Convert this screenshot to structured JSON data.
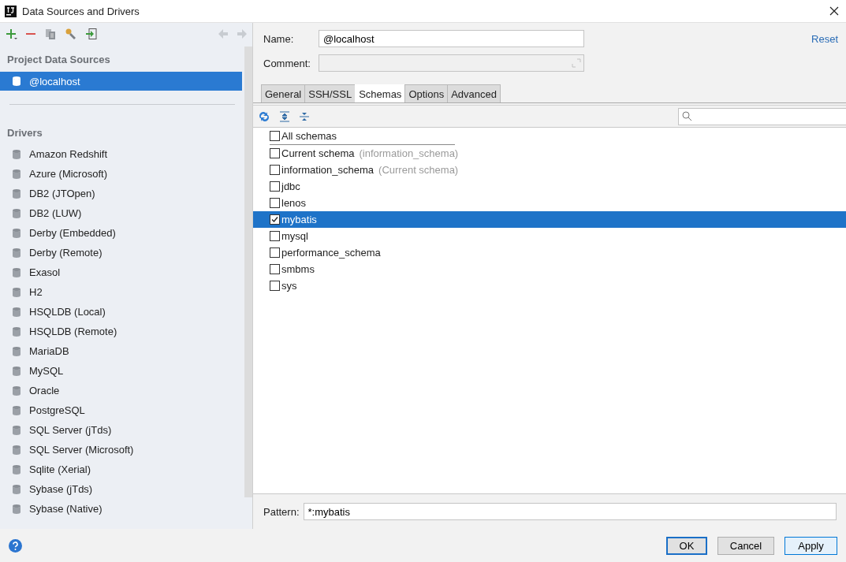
{
  "window": {
    "title": "Data Sources and Drivers"
  },
  "sidebar": {
    "sections": [
      {
        "title": "Project Data Sources",
        "items": [
          {
            "label": "@localhost",
            "selected": true
          }
        ]
      },
      {
        "title": "Drivers",
        "items": [
          {
            "label": "Amazon Redshift",
            "selected": false
          },
          {
            "label": "Azure (Microsoft)",
            "selected": false
          },
          {
            "label": "DB2 (JTOpen)",
            "selected": false
          },
          {
            "label": "DB2 (LUW)",
            "selected": false
          },
          {
            "label": "Derby (Embedded)",
            "selected": false
          },
          {
            "label": "Derby (Remote)",
            "selected": false
          },
          {
            "label": "Exasol",
            "selected": false
          },
          {
            "label": "H2",
            "selected": false
          },
          {
            "label": "HSQLDB (Local)",
            "selected": false
          },
          {
            "label": "HSQLDB (Remote)",
            "selected": false
          },
          {
            "label": "MariaDB",
            "selected": false
          },
          {
            "label": "MySQL",
            "selected": false
          },
          {
            "label": "Oracle",
            "selected": false
          },
          {
            "label": "PostgreSQL",
            "selected": false
          },
          {
            "label": "SQL Server (jTds)",
            "selected": false
          },
          {
            "label": "SQL Server (Microsoft)",
            "selected": false
          },
          {
            "label": "Sqlite (Xerial)",
            "selected": false
          },
          {
            "label": "Sybase (jTds)",
            "selected": false
          },
          {
            "label": "Sybase (Native)",
            "selected": false
          }
        ]
      }
    ]
  },
  "form": {
    "name_label": "Name:",
    "name_value": "@localhost",
    "comment_label": "Comment:",
    "reset": "Reset"
  },
  "tabs": [
    {
      "label": "General",
      "selected": false
    },
    {
      "label": "SSH/SSL",
      "selected": false
    },
    {
      "label": "Schemas",
      "selected": true
    },
    {
      "label": "Options",
      "selected": false
    },
    {
      "label": "Advanced",
      "selected": false
    }
  ],
  "schemas": [
    {
      "label": "All schemas",
      "checked": false,
      "selected": false
    },
    {
      "label": "Current schema",
      "note": "(information_schema)",
      "checked": false,
      "selected": false
    },
    {
      "label": "information_schema",
      "note": "(Current schema)",
      "checked": false,
      "selected": false
    },
    {
      "label": "jdbc",
      "checked": false,
      "selected": false
    },
    {
      "label": "lenos",
      "checked": false,
      "selected": false
    },
    {
      "label": "mybatis",
      "checked": true,
      "selected": true
    },
    {
      "label": "mysql",
      "checked": false,
      "selected": false
    },
    {
      "label": "performance_schema",
      "checked": false,
      "selected": false
    },
    {
      "label": "smbms",
      "checked": false,
      "selected": false
    },
    {
      "label": "sys",
      "checked": false,
      "selected": false
    }
  ],
  "pattern": {
    "label": "Pattern:",
    "value": "*:mybatis"
  },
  "buttons": [
    {
      "label": "OK",
      "kind": "focused"
    },
    {
      "label": "Cancel",
      "kind": "plain"
    },
    {
      "label": "Apply",
      "kind": "hover"
    }
  ]
}
